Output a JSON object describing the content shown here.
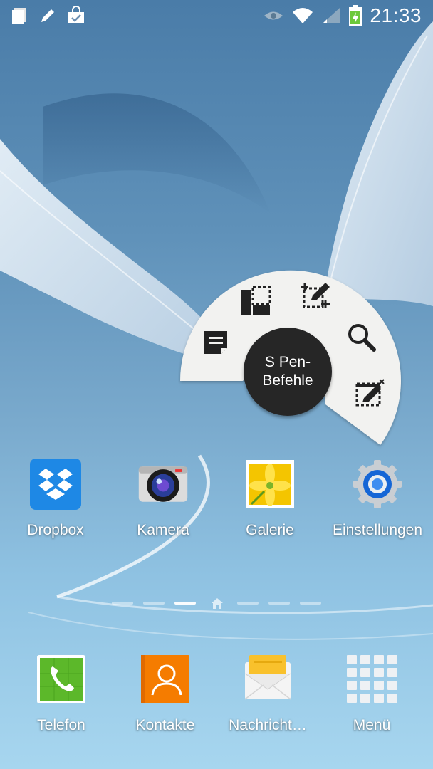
{
  "status_bar": {
    "left_icons": [
      "notes-icon",
      "pen-icon",
      "shopping-bag-icon"
    ],
    "right_icons": [
      "eye-icon",
      "wifi-icon",
      "signal-icon",
      "battery-charging-icon"
    ],
    "time": "21:33"
  },
  "spen_menu": {
    "center_label": "S Pen-\nBefehle",
    "actions": [
      {
        "icon": "memo-icon"
      },
      {
        "icon": "scrapbook-icon"
      },
      {
        "icon": "screen-write-icon"
      },
      {
        "icon": "search-icon"
      },
      {
        "icon": "screen-capture-icon"
      }
    ]
  },
  "home_apps": [
    {
      "label": "Dropbox",
      "icon": "dropbox-icon"
    },
    {
      "label": "Kamera",
      "icon": "camera-icon"
    },
    {
      "label": "Galerie",
      "icon": "gallery-icon"
    },
    {
      "label": "Einstellungen",
      "icon": "settings-gear-icon"
    }
  ],
  "page_indicator": {
    "pages": 7,
    "current_page": 3,
    "home_icon": "home-icon"
  },
  "dock": [
    {
      "label": "Telefon",
      "icon": "phone-icon"
    },
    {
      "label": "Kontakte",
      "icon": "contacts-icon"
    },
    {
      "label": "Nachricht…",
      "icon": "messages-icon"
    },
    {
      "label": "Menü",
      "icon": "app-grid-icon"
    }
  ],
  "colors": {
    "pen_menu_bg": "#f2f2f0",
    "pen_menu_center": "#262626",
    "dropbox_blue": "#1e88e5",
    "phone_green": "#5cb82a",
    "contacts_orange": "#f57c00",
    "messages_yellow": "#f9c12c"
  }
}
